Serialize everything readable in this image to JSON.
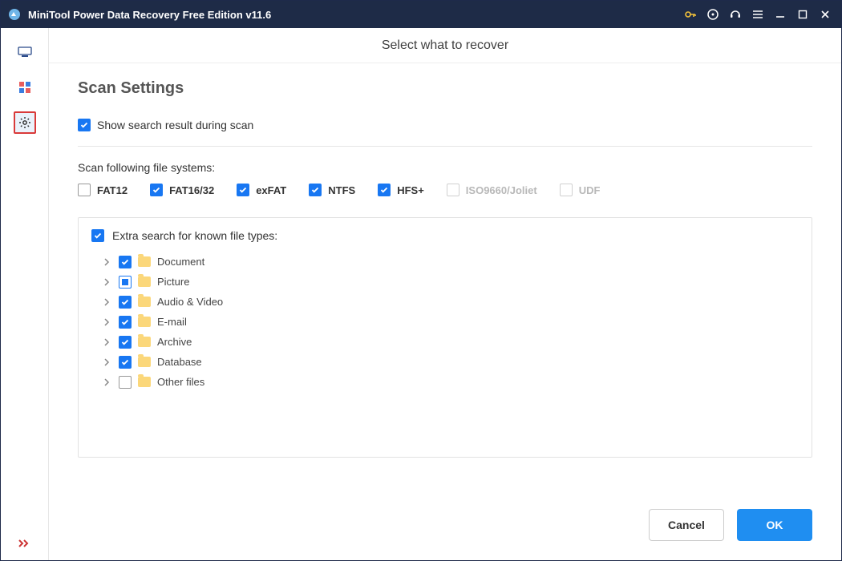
{
  "app": {
    "title": "MiniTool Power Data Recovery Free Edition v11.6"
  },
  "page": {
    "header": "Select what to recover",
    "section_title": "Scan Settings",
    "show_result_label": "Show search result during scan",
    "fs_label": "Scan following file systems:"
  },
  "filesystems": [
    {
      "key": "fat12",
      "label": "FAT12",
      "checked": false,
      "disabled": false
    },
    {
      "key": "fat1632",
      "label": "FAT16/32",
      "checked": true,
      "disabled": false
    },
    {
      "key": "exfat",
      "label": "exFAT",
      "checked": true,
      "disabled": false
    },
    {
      "key": "ntfs",
      "label": "NTFS",
      "checked": true,
      "disabled": false
    },
    {
      "key": "hfs",
      "label": "HFS+",
      "checked": true,
      "disabled": false
    },
    {
      "key": "iso",
      "label": "ISO9660/Joliet",
      "checked": false,
      "disabled": true
    },
    {
      "key": "udf",
      "label": "UDF",
      "checked": false,
      "disabled": true
    }
  ],
  "extra": {
    "header": "Extra search for known file types:",
    "checked": true,
    "items": [
      {
        "label": "Document",
        "state": "checked"
      },
      {
        "label": "Picture",
        "state": "indeterminate"
      },
      {
        "label": "Audio & Video",
        "state": "checked"
      },
      {
        "label": "E-mail",
        "state": "checked"
      },
      {
        "label": "Archive",
        "state": "checked"
      },
      {
        "label": "Database",
        "state": "checked"
      },
      {
        "label": "Other files",
        "state": "unchecked"
      }
    ]
  },
  "buttons": {
    "cancel": "Cancel",
    "ok": "OK"
  }
}
